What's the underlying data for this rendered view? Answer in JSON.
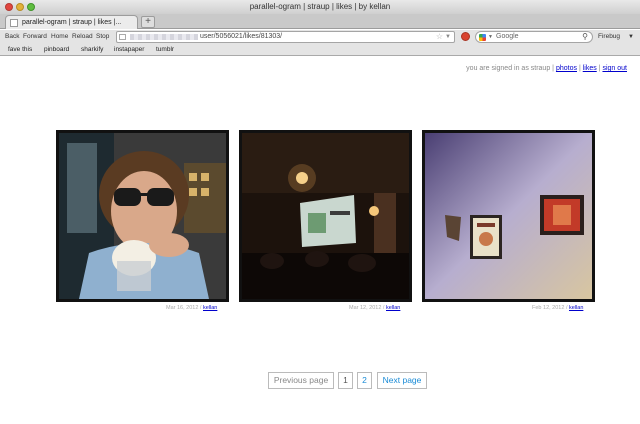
{
  "window": {
    "title": "parallel-ogram | straup | likes | by kellan"
  },
  "tabs": [
    {
      "label": "parallel-ogram | straup | likes |..."
    }
  ],
  "new_tab_label": "+",
  "navbar": {
    "back": "Back",
    "forward": "Forward",
    "home": "Home",
    "reload": "Reload",
    "stop": "Stop",
    "url": "user/5056021/likes/81303/",
    "search_placeholder": "Google",
    "firebug": "Firebug"
  },
  "bookmarks": [
    "fave this",
    "pinboard",
    "sharkify",
    "instapaper",
    "tumblr"
  ],
  "account": {
    "prefix": "you are signed in as straup |",
    "photos": "photos",
    "sep1": "|",
    "likes": "likes",
    "sep2": "|",
    "signout": "sign out"
  },
  "photos": [
    {
      "date": "Mar 16, 2012 /",
      "author": "kellan",
      "icon": "portrait-photo"
    },
    {
      "date": "Mar 12, 2012 /",
      "author": "kellan",
      "icon": "projection-room-photo"
    },
    {
      "date": "Feb 12, 2012 /",
      "author": "kellan",
      "icon": "framed-art-wall-photo"
    }
  ],
  "pagination": {
    "previous": "Previous page",
    "page1": "1",
    "page2": "2",
    "next": "Next page"
  },
  "colors": {
    "link": "#0000cc",
    "pager_link": "#1a8bd6",
    "photo_border": "#111111"
  }
}
